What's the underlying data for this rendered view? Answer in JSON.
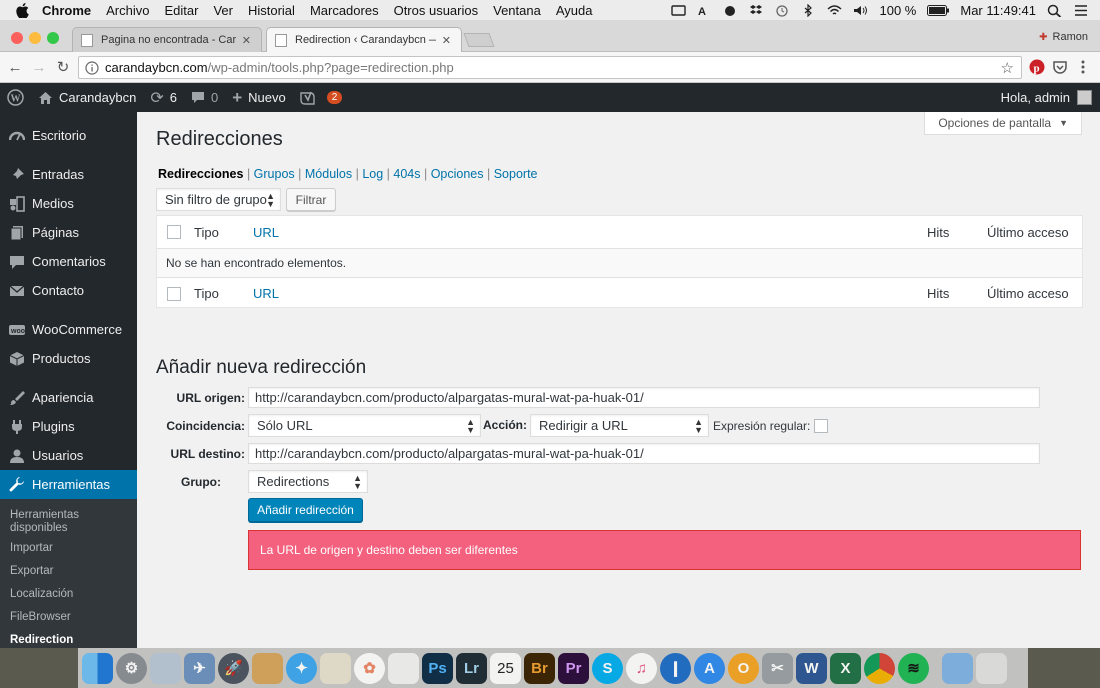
{
  "macos_menubar": {
    "app": "Chrome",
    "menus": [
      "Archivo",
      "Editar",
      "Ver",
      "Historial",
      "Marcadores",
      "Otros usuarios",
      "Ventana",
      "Ayuda"
    ],
    "battery": "100 %",
    "clock": "Mar 11:49:41"
  },
  "browser": {
    "tabs": [
      {
        "title": "Pagina no encontrada - Caranc",
        "active": false
      },
      {
        "title": "Redirection ‹ Carandaybcn — V",
        "active": true
      }
    ],
    "profile": "Ramon",
    "url_host": "carandaybcn.com",
    "url_path": "/wp-admin/tools.php?page=redirection.php"
  },
  "adminbar": {
    "site": "Carandaybcn",
    "updates": "6",
    "comments": "0",
    "new_label": "Nuevo",
    "yoast_badge": "2",
    "howdy": "Hola, admin"
  },
  "sidebar": {
    "items": [
      {
        "label": "Escritorio",
        "icon": "dashboard-icon"
      },
      {
        "label": "Entradas",
        "icon": "pin-icon"
      },
      {
        "label": "Medios",
        "icon": "media-icon"
      },
      {
        "label": "Páginas",
        "icon": "page-icon"
      },
      {
        "label": "Comentarios",
        "icon": "comment-icon"
      },
      {
        "label": "Contacto",
        "icon": "mail-icon"
      },
      {
        "label": "WooCommerce",
        "icon": "woo-icon"
      },
      {
        "label": "Productos",
        "icon": "box-icon"
      },
      {
        "label": "Apariencia",
        "icon": "brush-icon"
      },
      {
        "label": "Plugins",
        "icon": "plugin-icon"
      },
      {
        "label": "Usuarios",
        "icon": "user-icon"
      },
      {
        "label": "Herramientas",
        "icon": "wrench-icon"
      }
    ],
    "submenu": [
      "Herramientas disponibles",
      "Importar",
      "Exportar",
      "Localización",
      "FileBrowser",
      "Redirection"
    ]
  },
  "page": {
    "screen_options": "Opciones de pantalla",
    "title": "Redirecciones",
    "subnav": [
      "Redirecciones",
      "Grupos",
      "Módulos",
      "Log",
      "404s",
      "Opciones",
      "Soporte"
    ],
    "group_filter": "Sin filtro de grupo",
    "filter_button": "Filtrar",
    "table": {
      "col_type": "Tipo",
      "col_url": "URL",
      "col_hits": "Hits",
      "col_last": "Último acceso",
      "empty": "No se han encontrado elementos."
    },
    "form": {
      "heading": "Añadir nueva redirección",
      "source_label": "URL origen:",
      "source_value": "http://carandaybcn.com/producto/alpargatas-mural-wat-pa-huak-01/",
      "match_label": "Coincidencia:",
      "match_value": "Sólo URL",
      "action_label": "Acción:",
      "action_value": "Redirigir a URL",
      "regex_label": "Expresión regular:",
      "target_label": "URL destino:",
      "target_value": "http://carandaybcn.com/producto/alpargatas-mural-wat-pa-huak-01/",
      "group_label": "Grupo:",
      "group_value": "Redirections",
      "submit": "Añadir redirección"
    },
    "error": "La URL de origen y destino deben ser diferentes"
  },
  "dock": {
    "calendar_day": "25",
    "apps": [
      "finder-icon",
      "system-preferences-icon",
      "preview-icon",
      "mail-icon",
      "launchpad-icon",
      "notes-icon",
      "safari-icon",
      "contacts-icon",
      "photos-icon",
      "textedit-icon",
      "photoshop-icon",
      "lightroom-icon",
      "calendar-icon",
      "bridge-icon",
      "premiere-icon",
      "skype-icon",
      "itunes-icon",
      "1password-icon",
      "appstore-icon",
      "vlc-icon",
      "tools-icon",
      "word-icon",
      "excel-icon",
      "chrome-icon",
      "spotify-icon",
      "applications-folder-icon",
      "trash-icon"
    ],
    "labels": {
      "photoshop": "Ps",
      "lightroom": "Lr",
      "bridge": "Br",
      "premiere": "Pr",
      "skype": "S",
      "word": "W",
      "excel": "X"
    }
  }
}
